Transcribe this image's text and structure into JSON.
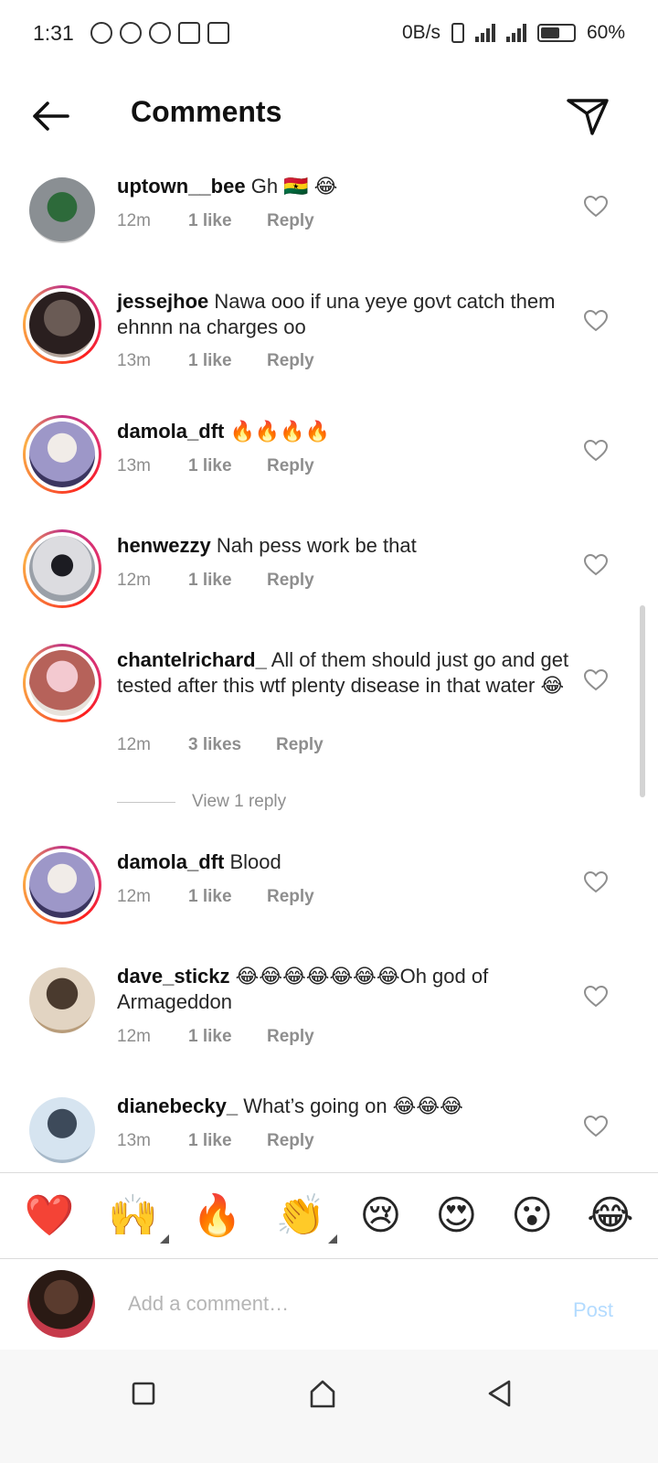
{
  "status_bar": {
    "time": "1:31",
    "network_speed": "0B/s",
    "battery": "60%",
    "battery_level": 0.6
  },
  "header": {
    "title": "Comments",
    "back_icon": "arrow-left-icon",
    "send_icon": "paper-plane-icon"
  },
  "comments": [
    {
      "username": "uptown__bee",
      "text": "Gh 🇬🇭 😂",
      "time": "12m",
      "likes": "1 like",
      "reply": "Reply",
      "avatar_colors": [
        "#8a8f93",
        "#2d6a3a"
      ]
    },
    {
      "username": "jessejhoe",
      "text": "Nawa ooo if una yeye govt catch them ehnnn na charges oo",
      "time": "13m",
      "likes": "1 like",
      "reply": "Reply",
      "avatar_colors": [
        "#6a5b55",
        "#2a1f1f"
      ]
    },
    {
      "username": "damola_dft",
      "text": "🔥🔥🔥🔥",
      "time": "13m",
      "likes": "1 like",
      "reply": "Reply",
      "avatar_colors": [
        "#9d97c8",
        "#3b3560"
      ]
    },
    {
      "username": "henwezzy",
      "text": "Nah pess work be that",
      "time": "12m",
      "likes": "1 like",
      "reply": "Reply",
      "avatar_colors": [
        "#dcdce0",
        "#4a4a55"
      ]
    },
    {
      "username": "chantelrichard_",
      "text": "All of them should just go and get tested after this wtf plenty disease in that water 😂",
      "time": "12m",
      "likes": "3 likes",
      "reply": "Reply",
      "avatar_colors": [
        "#f3c9d0",
        "#b6625a"
      ]
    },
    {
      "username": "damola_dft",
      "text": "Blood",
      "time": "12m",
      "likes": "1 like",
      "reply": "Reply",
      "avatar_colors": [
        "#9d97c8",
        "#3b3560"
      ]
    },
    {
      "username": "dave_stickz",
      "text": "😂😂😂😂😂😂😂Oh god of Armageddon",
      "time": "12m",
      "likes": "1 like",
      "reply": "Reply",
      "avatar_colors": [
        "#e2d4c2",
        "#4a3a2e"
      ]
    },
    {
      "username": "dianebecky_",
      "text": "What’s going on 😂😂😂",
      "time": "13m",
      "likes": "1 like",
      "reply": "Reply",
      "avatar_colors": [
        "#d6e4f0",
        "#3d4a5a"
      ]
    }
  ],
  "view_replies": "View 1 reply",
  "emoji_bar": [
    "❤️",
    "🙌",
    "🔥",
    "👏",
    "😢",
    "😍",
    "😮",
    "😂"
  ],
  "comment_input": {
    "placeholder": "Add a comment…",
    "post_label": "Post"
  }
}
